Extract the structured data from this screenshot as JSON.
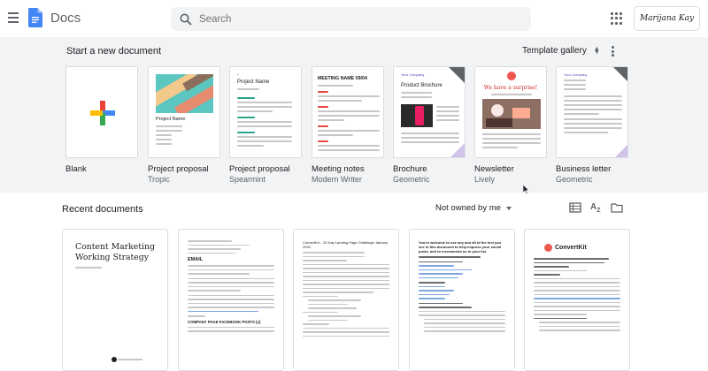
{
  "header": {
    "app_title": "Docs",
    "search_placeholder": "Search",
    "account_name": "Marijana Kay"
  },
  "templates": {
    "title": "Start a new document",
    "gallery_label": "Template gallery",
    "items": [
      {
        "name": "Blank",
        "sub": ""
      },
      {
        "name": "Project proposal",
        "sub": "Tropic",
        "thumb_title": "Project Name"
      },
      {
        "name": "Project proposal",
        "sub": "Spearmint",
        "thumb_title": "Project Name"
      },
      {
        "name": "Meeting notes",
        "sub": "Modern Writer",
        "thumb_title": "MEETING NAME 09/04"
      },
      {
        "name": "Brochure",
        "sub": "Geometric",
        "thumb_brand": "Your Company",
        "thumb_title": "Product Brochure"
      },
      {
        "name": "Newsletter",
        "sub": "Lively",
        "thumb_title": "We have a surprise!"
      },
      {
        "name": "Business letter",
        "sub": "Geometric",
        "thumb_brand": "Your Company"
      }
    ]
  },
  "recent": {
    "title": "Recent documents",
    "owner_filter": "Not owned by me",
    "docs": [
      {
        "title": "Content Marketing Working Strategy"
      },
      {
        "heading": "EMAIL",
        "sub_heading": "COMPANY PAGE FACEBOOK POSTS [x]"
      },
      {
        "title": "ConvertKit – 30 Day Landing Page Challenge January 2020"
      },
      {
        "title": "You're welcome to use any and all of the text you see in this document to help improve your social posts, and to recommend us to your list."
      },
      {
        "brand": "ConvertKit"
      }
    ]
  },
  "colors": {
    "docs_blue": "#4285f4",
    "background_gray": "#f1f3f4",
    "text_secondary": "#5f6368",
    "convertkit_red": "#ef5a4f"
  }
}
